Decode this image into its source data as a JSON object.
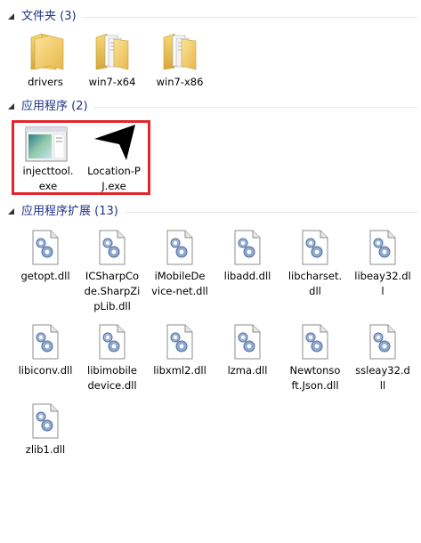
{
  "groups": {
    "folders": {
      "title": "文件夹 (3)"
    },
    "apps": {
      "title": "应用程序 (2)"
    },
    "extensions": {
      "title": "应用程序扩展 (13)"
    }
  },
  "folders": [
    {
      "label": "drivers"
    },
    {
      "label": "win7-x64"
    },
    {
      "label": "win7-x86"
    }
  ],
  "apps": [
    {
      "label": "injecttool.\nexe"
    },
    {
      "label": "Location-P\nJ.exe"
    }
  ],
  "extensions": [
    {
      "label": "getopt.dll"
    },
    {
      "label": "ICSharpCo\nde.SharpZi\npLib.dll"
    },
    {
      "label": "iMobileDe\nvice-net.dll"
    },
    {
      "label": "libadd.dll"
    },
    {
      "label": "libcharset.\ndll"
    },
    {
      "label": "libeay32.dl\nl"
    },
    {
      "label": "libiconv.dll"
    },
    {
      "label": "libimobile\ndevice.dll"
    },
    {
      "label": "libxml2.dll"
    },
    {
      "label": "lzma.dll"
    },
    {
      "label": "Newtonso\nft.Json.dll"
    },
    {
      "label": "ssleay32.d\nll"
    },
    {
      "label": "zlib1.dll"
    }
  ],
  "colors": {
    "header_text": "#1e3287",
    "highlight_border": "#e0262b"
  },
  "icons": {
    "folder": "folder-icon",
    "exe": "application-window-icon",
    "cursor": "arrow-cursor-icon",
    "dll": "dll-gear-icon"
  }
}
